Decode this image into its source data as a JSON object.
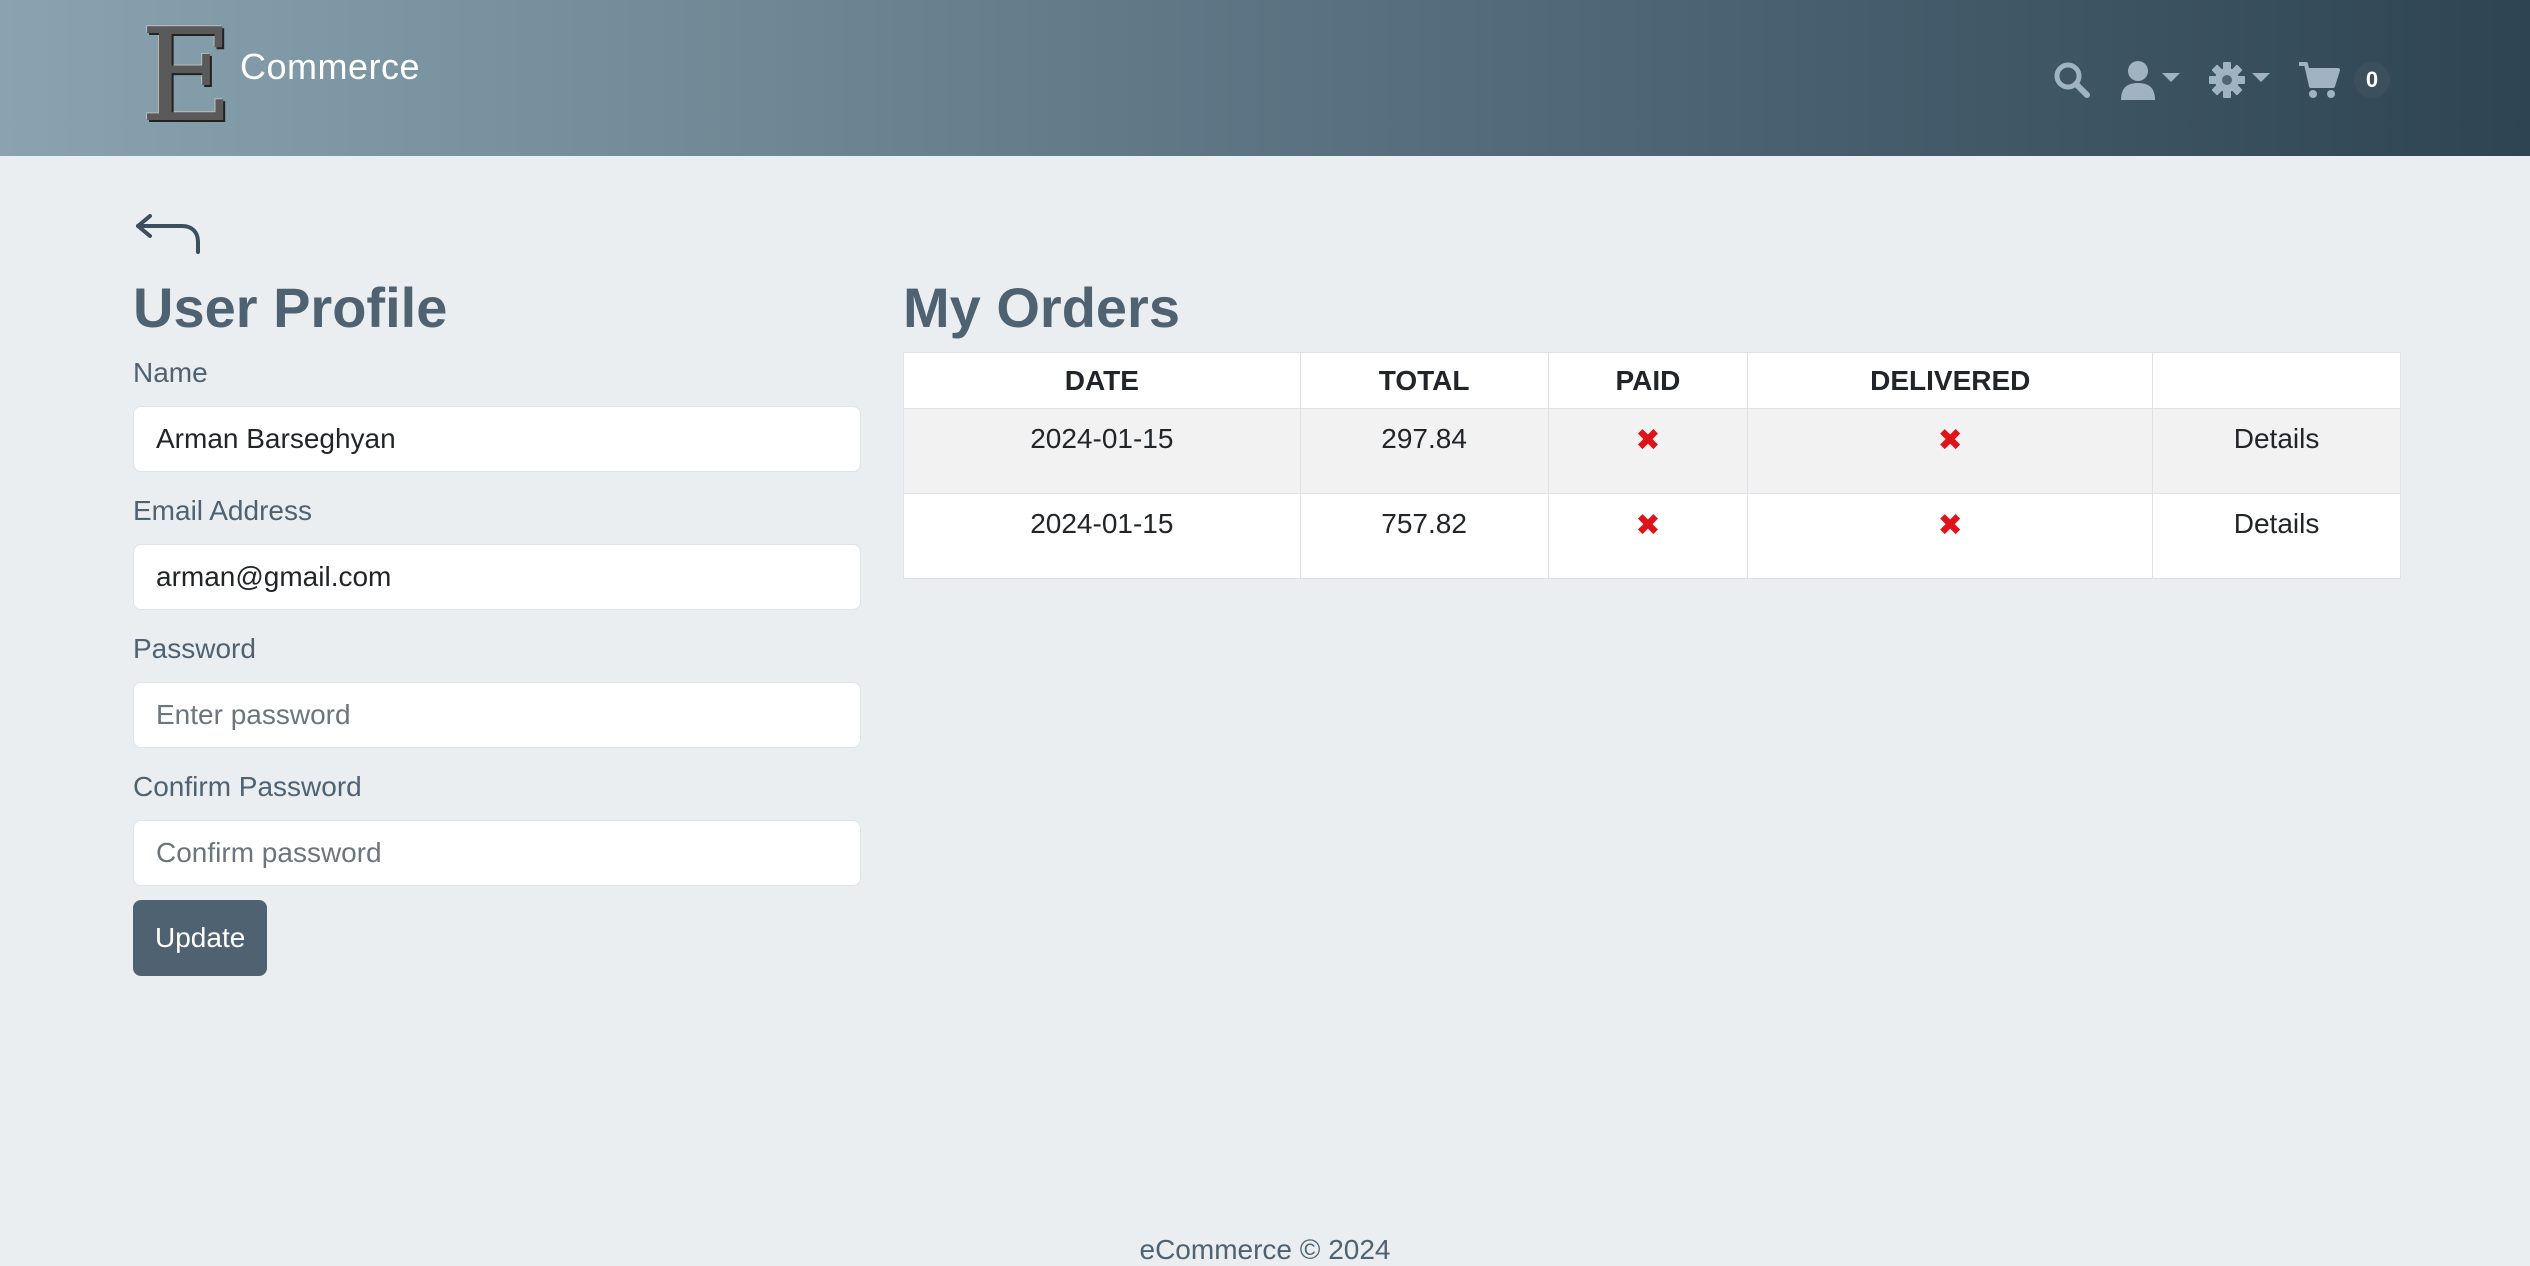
{
  "header": {
    "logo_letter": "E",
    "brand_name": "Commerce",
    "cart_count": "0",
    "icons": [
      "search-icon",
      "user-icon",
      "gear-icon",
      "cart-icon"
    ],
    "colors": {
      "gradient_start": "#8aa3b0",
      "gradient_end": "#2e4452"
    }
  },
  "profile": {
    "title": "User Profile",
    "name_label": "Name",
    "name_value": "Arman Barseghyan",
    "email_label": "Email Address",
    "email_value": "arman@gmail.com",
    "password_label": "Password",
    "password_placeholder": "Enter password",
    "confirm_label": "Confirm Password",
    "confirm_placeholder": "Confirm password",
    "update_label": "Update"
  },
  "orders": {
    "title": "My Orders",
    "columns": [
      "DATE",
      "TOTAL",
      "PAID",
      "DELIVERED",
      ""
    ],
    "rows": [
      {
        "date": "2024-01-15",
        "total": "297.84",
        "paid": "✖",
        "delivered": "✖",
        "action": "Details"
      },
      {
        "date": "2024-01-15",
        "total": "757.82",
        "paid": "✖",
        "delivered": "✖",
        "action": "Details"
      }
    ]
  },
  "footer": {
    "text": "eCommerce © 2024"
  },
  "colors": {
    "accent": "#4e6272",
    "status_no": "#e0121a",
    "background": "#eaeef1"
  }
}
